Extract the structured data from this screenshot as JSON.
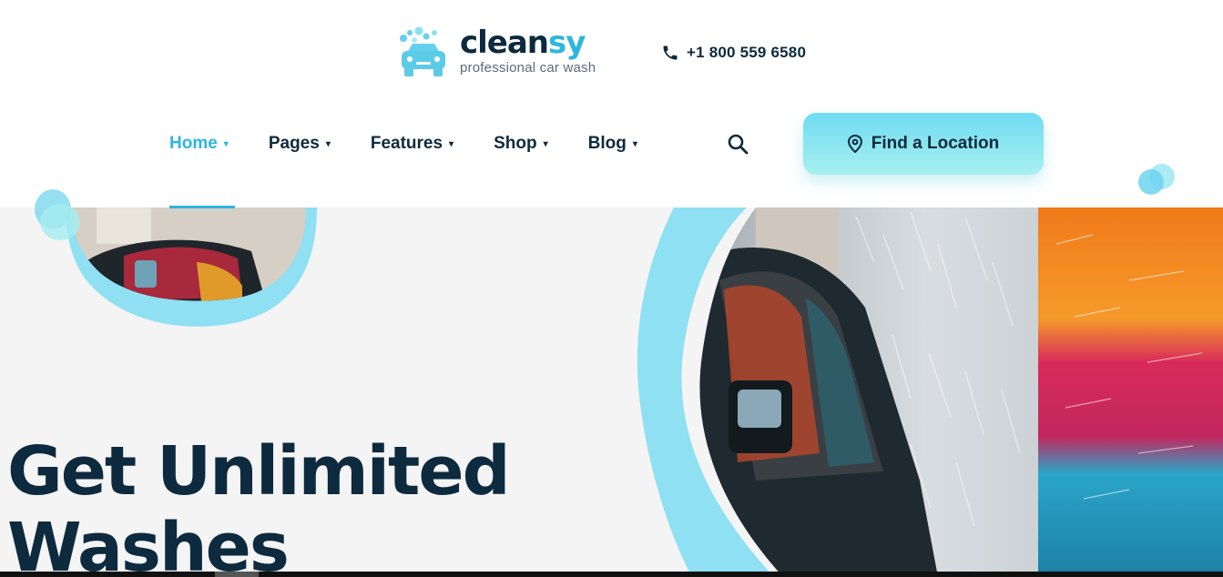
{
  "brand": {
    "name_part1": "clean",
    "name_part2": "sy",
    "tagline": "professional car wash",
    "accent_color": "#2cb6e0",
    "dark_color": "#0d2a3e"
  },
  "header": {
    "phone": "+1 800 559 6580",
    "phone_icon": "phone-icon"
  },
  "nav": {
    "items": [
      {
        "label": "Home",
        "active": true
      },
      {
        "label": "Pages",
        "active": false
      },
      {
        "label": "Features",
        "active": false
      },
      {
        "label": "Shop",
        "active": false
      },
      {
        "label": "Blog",
        "active": false
      }
    ],
    "caret": "▾",
    "search_icon": "search-icon",
    "cta_label": "Find a Location",
    "cta_icon": "map-pin-icon"
  },
  "hero": {
    "title_line1": "Get Unlimited",
    "title_line2": "Washes"
  }
}
